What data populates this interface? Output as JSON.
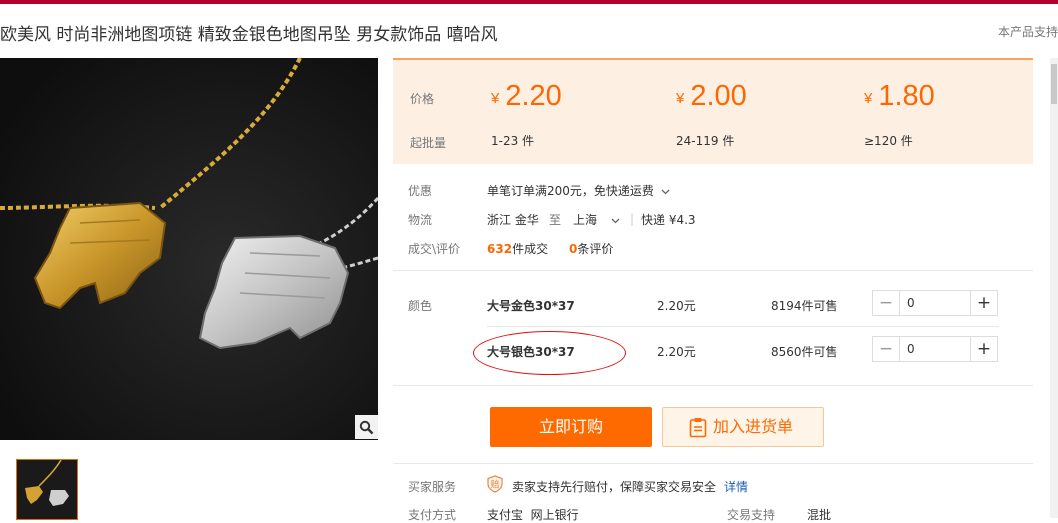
{
  "title": "欧美风 时尚非洲地图项链 精致金银色地图吊坠 男女款饰品 嘻哈风",
  "top_link": "本产品支持",
  "price_panel": {
    "price_label": "价格",
    "min_label": "起批量",
    "currency": "¥",
    "tiers": [
      {
        "price": "2.20",
        "qty": "1-23 件"
      },
      {
        "price": "2.00",
        "qty": "24-119 件"
      },
      {
        "price": "1.80",
        "qty": "≥120 件"
      }
    ]
  },
  "info": {
    "promo_label": "优惠",
    "promo_text": "单笔订单满200元，免快递运费",
    "logistics_label": "物流",
    "from": "浙江 金华",
    "to_word": "至",
    "dest": "上海",
    "express": "快递 ¥4.3",
    "deal_label": "成交\\评价",
    "deals_count": "632",
    "deals_text": "件成交",
    "reviews_count": "0",
    "reviews_text": "条评价"
  },
  "sku": {
    "color_label": "颜色",
    "items": [
      {
        "name": "大号金色30*37",
        "price": "2.20元",
        "stock": "8194件可售",
        "qty": "0"
      },
      {
        "name": "大号银色30*37",
        "price": "2.20元",
        "stock": "8560件可售",
        "qty": "0"
      }
    ]
  },
  "actions": {
    "buy_label": "立即订购",
    "cart_label": "加入进货单"
  },
  "service": {
    "label": "买家服务",
    "badge": "赔",
    "text": "卖家支持先行赔付，保障买家交易安全",
    "detail_link": "详情"
  },
  "payment": {
    "label": "支付方式",
    "methods": "支付宝  网上银行",
    "trade_label": "交易支持",
    "trade_value": "混批"
  },
  "colors": {
    "accent": "#ff6600",
    "price_bg": "#fdf0e3",
    "topbar": "#b3002d",
    "annotation": "#e01010"
  }
}
